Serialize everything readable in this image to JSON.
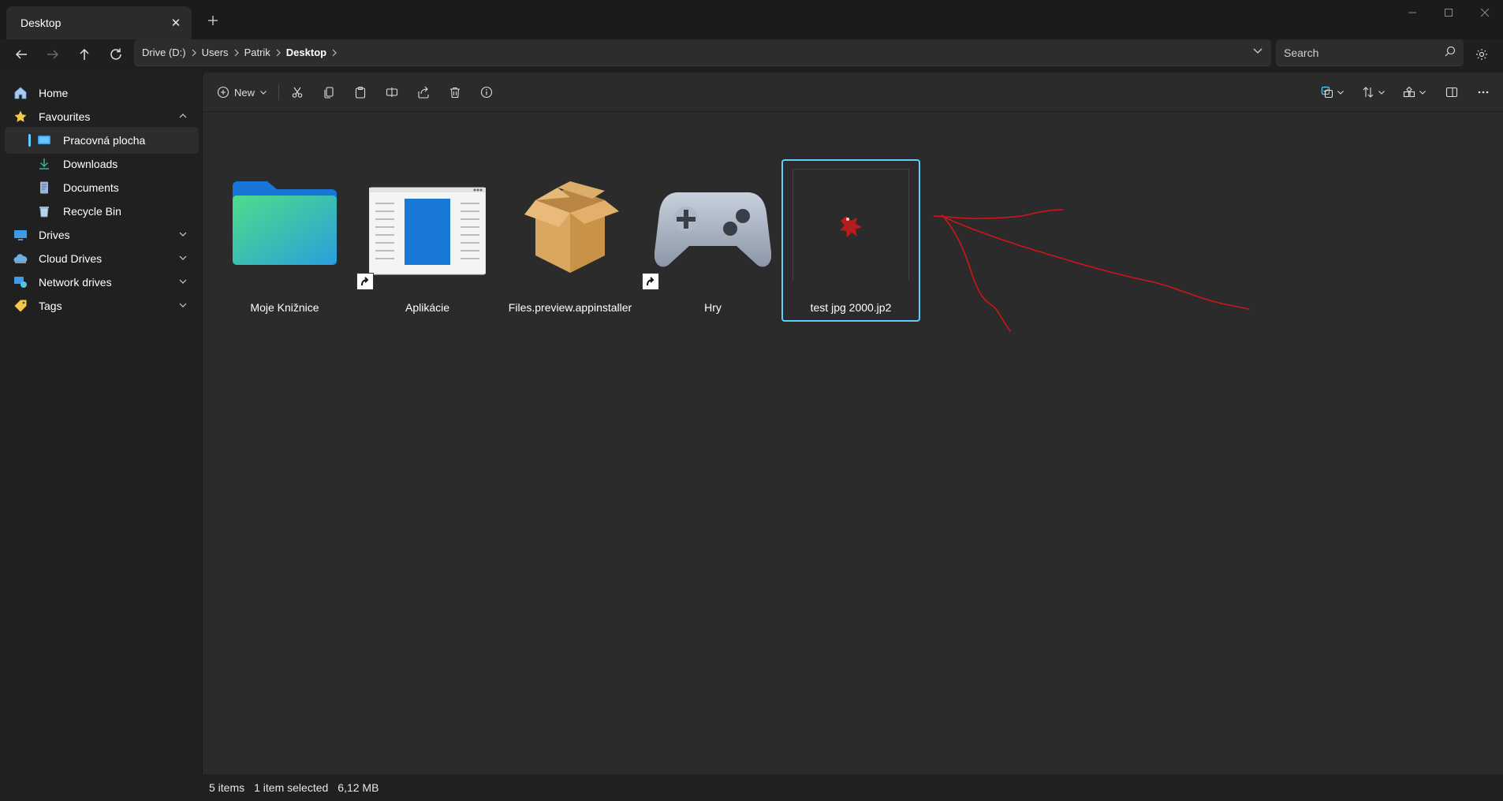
{
  "window": {
    "tab_title": "Desktop",
    "controls": [
      "minimize",
      "maximize",
      "close"
    ]
  },
  "address": {
    "crumbs": [
      "Drive (D:)",
      "Users",
      "Patrik",
      "Desktop"
    ]
  },
  "search": {
    "placeholder": "Search",
    "value": ""
  },
  "sidebar": {
    "items": [
      {
        "label": "Home",
        "icon": "home-icon"
      },
      {
        "label": "Favourites",
        "icon": "star-icon"
      },
      {
        "label": "Pracovná plocha",
        "icon": "desktop-icon",
        "selected": true
      },
      {
        "label": "Downloads",
        "icon": "download-icon"
      },
      {
        "label": "Documents",
        "icon": "document-icon"
      },
      {
        "label": "Recycle Bin",
        "icon": "recycle-bin-icon"
      },
      {
        "label": "Drives",
        "icon": "drive-icon"
      },
      {
        "label": "Cloud Drives",
        "icon": "cloud-icon"
      },
      {
        "label": "Network drives",
        "icon": "network-icon"
      },
      {
        "label": "Tags",
        "icon": "tag-icon"
      }
    ]
  },
  "toolbar": {
    "new_label": "New",
    "actions": [
      "cut",
      "copy",
      "paste",
      "rename",
      "share",
      "delete",
      "properties"
    ]
  },
  "files": [
    {
      "name": "Moje Knižnice",
      "icon": "folder-icon",
      "shortcut": false,
      "selected": false
    },
    {
      "name": "Aplikácie",
      "icon": "app-window-icon",
      "shortcut": true,
      "selected": false
    },
    {
      "name": "Files.preview.appinstaller",
      "icon": "package-box-icon",
      "shortcut": false,
      "selected": false
    },
    {
      "name": "Hry",
      "icon": "gamepad-icon",
      "shortcut": true,
      "selected": false
    },
    {
      "name": "test jpg 2000.jp2",
      "icon": "image-thumbnail-icon",
      "shortcut": false,
      "selected": true
    }
  ],
  "status": {
    "item_count": "5 items",
    "selection": "1 item selected",
    "size": "6,12 MB"
  },
  "colors": {
    "accent": "#60cdff",
    "annotation": "#d0141a",
    "background": "#2b2b2b"
  }
}
